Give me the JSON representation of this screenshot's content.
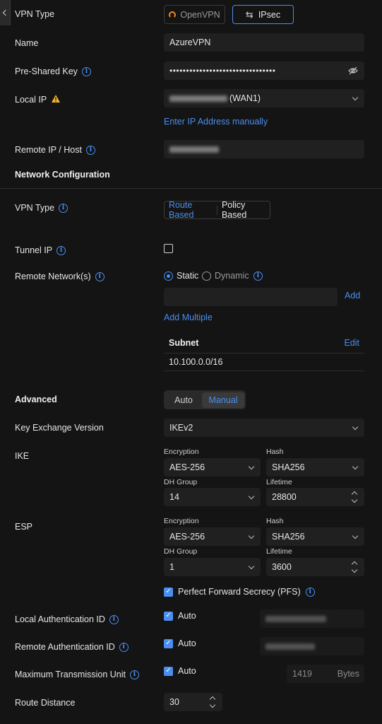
{
  "vpn_type": {
    "label": "VPN Type",
    "options": [
      "OpenVPN",
      "IPsec"
    ],
    "selected": "IPsec"
  },
  "name": {
    "label": "Name",
    "value": "AzureVPN"
  },
  "psk": {
    "label": "Pre-Shared Key",
    "value": "••••••••••••••••••••••••••••••••"
  },
  "local_ip": {
    "label": "Local IP",
    "suffix": "(WAN1)",
    "manual_link": "Enter IP Address manually"
  },
  "remote_ip": {
    "label": "Remote IP / Host"
  },
  "network_config": {
    "title": "Network Configuration"
  },
  "vpn_mode": {
    "label": "VPN Type",
    "options": [
      "Route Based",
      "Policy Based"
    ],
    "selected": "Route Based"
  },
  "tunnel_ip": {
    "label": "Tunnel IP"
  },
  "remote_networks": {
    "label": "Remote Network(s)",
    "options": [
      "Static",
      "Dynamic"
    ],
    "selected": "Static",
    "add_label": "Add",
    "add_multiple": "Add Multiple",
    "table_header": "Subnet",
    "edit_label": "Edit",
    "subnets": [
      "10.100.0.0/16"
    ]
  },
  "advanced": {
    "label": "Advanced",
    "options": [
      "Auto",
      "Manual"
    ],
    "selected": "Manual"
  },
  "key_exchange": {
    "label": "Key Exchange Version",
    "value": "IKEv2"
  },
  "ike": {
    "label": "IKE",
    "encryption_label": "Encryption",
    "encryption": "AES-256",
    "hash_label": "Hash",
    "hash": "SHA256",
    "dh_label": "DH Group",
    "dh": "14",
    "lifetime_label": "Lifetime",
    "lifetime": "28800"
  },
  "esp": {
    "label": "ESP",
    "encryption_label": "Encryption",
    "encryption": "AES-256",
    "hash_label": "Hash",
    "hash": "SHA256",
    "dh_label": "DH Group",
    "dh": "1",
    "lifetime_label": "Lifetime",
    "lifetime": "3600",
    "pfs_label": "Perfect Forward Secrecy (PFS)"
  },
  "local_auth": {
    "label": "Local Authentication ID",
    "checkbox": "Auto"
  },
  "remote_auth": {
    "label": "Remote Authentication ID",
    "checkbox": "Auto"
  },
  "mtu": {
    "label": "Maximum Transmission Unit",
    "checkbox": "Auto",
    "value": "1419",
    "unit": "Bytes"
  },
  "route_distance": {
    "label": "Route Distance",
    "value": "30"
  },
  "colors": {
    "accent": "#4a8ef0",
    "background": "#141414",
    "field": "#202020",
    "warning": "#f0b429"
  }
}
